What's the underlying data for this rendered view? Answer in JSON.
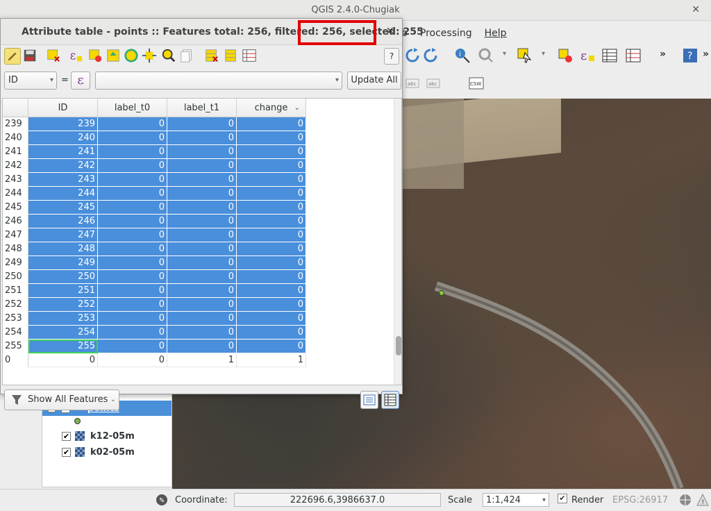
{
  "main_window": {
    "title": "QGIS 2.4.0-Chugiak",
    "menu": [
      "b",
      "Processing",
      "Help"
    ]
  },
  "dialog": {
    "title": "Attribute table - points :: Features total: 256, filtered: 256, ",
    "selected": "selected: 255",
    "help": "?",
    "field_combo": "ID",
    "equals": "=",
    "expression_symbol": "ε",
    "expression_value": "",
    "update_all": "Update All",
    "show_features": "Show All Features"
  },
  "table": {
    "columns": [
      "ID",
      "label_t0",
      "label_t1",
      "change"
    ],
    "rows": [
      {
        "rh": "239",
        "cells": [
          "239",
          "0",
          "0",
          "0"
        ],
        "selected": true
      },
      {
        "rh": "240",
        "cells": [
          "240",
          "0",
          "0",
          "0"
        ],
        "selected": true
      },
      {
        "rh": "241",
        "cells": [
          "241",
          "0",
          "0",
          "0"
        ],
        "selected": true
      },
      {
        "rh": "242",
        "cells": [
          "242",
          "0",
          "0",
          "0"
        ],
        "selected": true
      },
      {
        "rh": "243",
        "cells": [
          "243",
          "0",
          "0",
          "0"
        ],
        "selected": true
      },
      {
        "rh": "244",
        "cells": [
          "244",
          "0",
          "0",
          "0"
        ],
        "selected": true
      },
      {
        "rh": "245",
        "cells": [
          "245",
          "0",
          "0",
          "0"
        ],
        "selected": true
      },
      {
        "rh": "246",
        "cells": [
          "246",
          "0",
          "0",
          "0"
        ],
        "selected": true
      },
      {
        "rh": "247",
        "cells": [
          "247",
          "0",
          "0",
          "0"
        ],
        "selected": true
      },
      {
        "rh": "248",
        "cells": [
          "248",
          "0",
          "0",
          "0"
        ],
        "selected": true
      },
      {
        "rh": "249",
        "cells": [
          "249",
          "0",
          "0",
          "0"
        ],
        "selected": true
      },
      {
        "rh": "250",
        "cells": [
          "250",
          "0",
          "0",
          "0"
        ],
        "selected": true
      },
      {
        "rh": "251",
        "cells": [
          "251",
          "0",
          "0",
          "0"
        ],
        "selected": true
      },
      {
        "rh": "252",
        "cells": [
          "252",
          "0",
          "0",
          "0"
        ],
        "selected": true
      },
      {
        "rh": "253",
        "cells": [
          "253",
          "0",
          "0",
          "0"
        ],
        "selected": true
      },
      {
        "rh": "254",
        "cells": [
          "254",
          "0",
          "0",
          "0"
        ],
        "selected": true
      },
      {
        "rh": "255",
        "cells": [
          "255",
          "0",
          "0",
          "0"
        ],
        "selected": true,
        "focus": true
      },
      {
        "rh": "0",
        "cells": [
          "0",
          "0",
          "1",
          "1"
        ],
        "selected": false
      }
    ]
  },
  "layers": {
    "items": [
      {
        "name": "points",
        "checked": true,
        "selected": true
      },
      {
        "name": "k12-05m",
        "checked": true,
        "selected": false
      },
      {
        "name": "k02-05m",
        "checked": true,
        "selected": false
      }
    ]
  },
  "statusbar": {
    "coordinate_label": "Coordinate:",
    "coordinate_value": "222696.6,3986637.0",
    "scale_label": "Scale",
    "scale_value": "1:1,424",
    "render_label": "Render",
    "crs": "EPSG:26917"
  },
  "colors": {
    "selection": "#4a8fdb",
    "highlight_box": "#e00000",
    "focus_outline": "#3fd05b"
  }
}
